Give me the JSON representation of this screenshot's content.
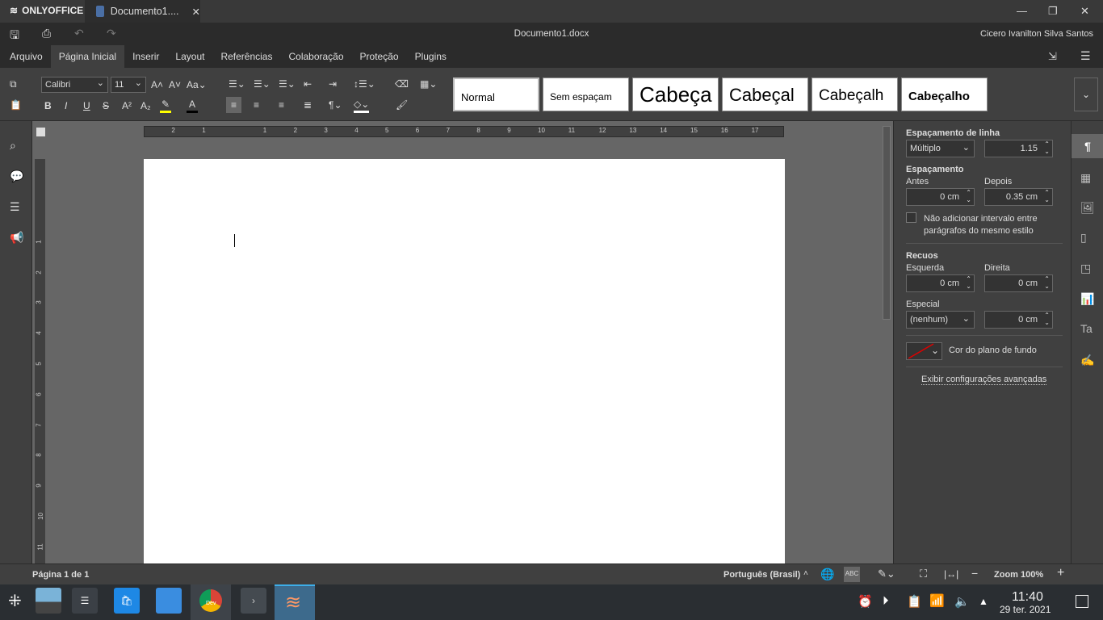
{
  "app": {
    "brand": "ONLYOFFICE",
    "tab_title": "Documento1....",
    "doc_title": "Documento1.docx",
    "user": "Cicero Ivanilton Silva Santos"
  },
  "menu": [
    "Arquivo",
    "Página Inicial",
    "Inserir",
    "Layout",
    "Referências",
    "Colaboração",
    "Proteção",
    "Plugins"
  ],
  "toolbar": {
    "font": "Calibri",
    "size": "11",
    "styles": [
      "Normal",
      "Sem espaçam",
      "Cabeça",
      "Cabeçal",
      "Cabeçalh",
      "Cabeçalho"
    ]
  },
  "ruler": {
    "h": [
      "2",
      "1",
      "1",
      "2",
      "3",
      "4",
      "5",
      "6",
      "7",
      "8",
      "9",
      "10",
      "11",
      "12",
      "13",
      "14",
      "15",
      "16",
      "17"
    ]
  },
  "panel": {
    "line_spacing": "Espaçamento de linha",
    "line_mode": "Múltiplo",
    "line_value": "1.15",
    "spacing": "Espaçamento",
    "before": "Antes",
    "after": "Depois",
    "before_val": "0 cm",
    "after_val": "0.35 cm",
    "no_interval": "Não adicionar intervalo entre parágrafos do mesmo estilo",
    "indents": "Recuos",
    "left": "Esquerda",
    "right": "Direita",
    "left_val": "0 cm",
    "right_val": "0 cm",
    "special": "Especial",
    "special_mode": "(nenhum)",
    "special_val": "0 cm",
    "bg_color": "Cor do plano de fundo",
    "advanced": "Exibir configurações avançadas"
  },
  "status": {
    "page": "Página 1 de 1",
    "lang": "Português (Brasil)",
    "zoom": "Zoom 100%"
  },
  "taskbar": {
    "time": "11:40",
    "date": "29 ter. 2021",
    "chrome_badge": "Dev"
  },
  "colors": {
    "accent": "#404040",
    "highlight": "#ffff00",
    "fontcolor": "#000000"
  }
}
